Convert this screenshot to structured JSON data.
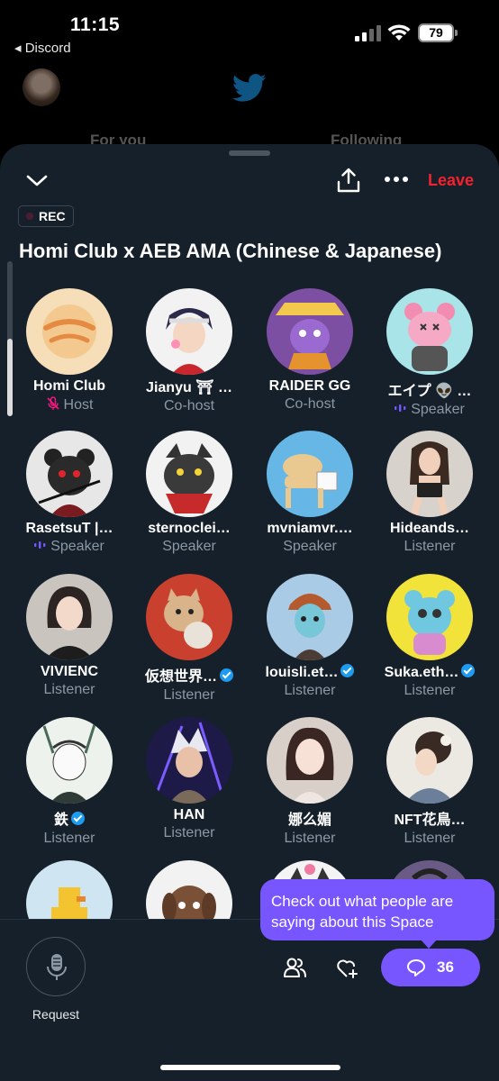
{
  "status_bar": {
    "time": "11:15",
    "back_label": "◂ Discord",
    "battery": "79"
  },
  "background_app": {
    "tabs": [
      "For you",
      "Following"
    ]
  },
  "space": {
    "leave_label": "Leave",
    "rec_label": "REC",
    "title": "Homi Club x AEB AMA (Chinese & Japanese)",
    "participants": [
      {
        "name": "Homi Club",
        "role": "Host",
        "role_icon": "mic-muted-icon",
        "verified": false
      },
      {
        "name": "Jianyu ⛩ …",
        "role": "Co-host",
        "role_icon": "",
        "verified": false
      },
      {
        "name": "RAIDER GG",
        "role": "Co-host",
        "role_icon": "",
        "verified": false
      },
      {
        "name": "エイプ 👽 …",
        "role": "Speaker",
        "role_icon": "speaking-bars-icon",
        "verified": false
      },
      {
        "name": "RasetsuT |…",
        "role": "Speaker",
        "role_icon": "speaking-bars-icon",
        "verified": false
      },
      {
        "name": "sternoclei…",
        "role": "Speaker",
        "role_icon": "",
        "verified": false
      },
      {
        "name": "mvniamvr.…",
        "role": "Speaker",
        "role_icon": "",
        "verified": false
      },
      {
        "name": "Hideands…",
        "role": "Listener",
        "role_icon": "",
        "verified": false
      },
      {
        "name": "VIVIENC",
        "role": "Listener",
        "role_icon": "",
        "verified": false
      },
      {
        "name": "仮想世界…",
        "role": "Listener",
        "role_icon": "",
        "verified": true
      },
      {
        "name": "louisli.et…",
        "role": "Listener",
        "role_icon": "",
        "verified": true
      },
      {
        "name": "Suka.eth…",
        "role": "Listener",
        "role_icon": "",
        "verified": true
      },
      {
        "name": "鉄",
        "role": "Listener",
        "role_icon": "",
        "verified": true
      },
      {
        "name": "HAN",
        "role": "Listener",
        "role_icon": "",
        "verified": false
      },
      {
        "name": "娜么媚",
        "role": "Listener",
        "role_icon": "",
        "verified": false
      },
      {
        "name": "NFT花鳥…",
        "role": "Listener",
        "role_icon": "",
        "verified": false
      }
    ]
  },
  "bottom_bar": {
    "request_label": "Request",
    "comments_count": "36",
    "tooltip": "Check out what people are saying about this Space"
  },
  "colors": {
    "accent": "#7856ff",
    "leave": "#f4212e",
    "verified": "#1d9bf0",
    "sheet_bg": "#16202b"
  }
}
